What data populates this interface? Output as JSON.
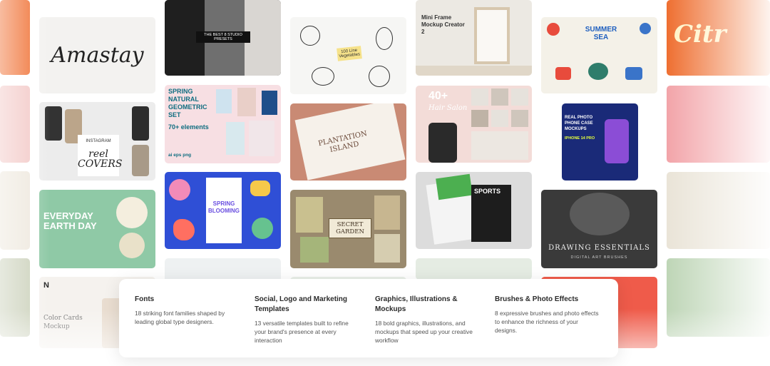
{
  "tiles": {
    "amastay": {
      "title": "Amastay"
    },
    "studio": {
      "title": "THE BEST 8 STUDIO PRESETS"
    },
    "veg": {
      "title": "100 Line Vegetables"
    },
    "miniframe": {
      "title": "Mini Frame Mockup Creator 2"
    },
    "summersea": {
      "title": "SUMMER SEA"
    },
    "citrus": {
      "title": "Citr"
    },
    "reel": {
      "title": "INSTAGRAM",
      "subtitle": "reel COVERS"
    },
    "geometric": {
      "title": "SPRING NATURAL GEOMETRIC SET",
      "count": "70+ elements",
      "formats": "ai eps png"
    },
    "plantation": {
      "title": "PLANTATION ISLAND"
    },
    "hairsalon": {
      "count": "40+",
      "title": "Hair Salon"
    },
    "phonecase": {
      "title": "REAL PHOTO PHONE CASE MOCKUPS",
      "subtitle": "IPHONE 14 PRO"
    },
    "earthday": {
      "title": "EVERYDAY EARTH DAY"
    },
    "blooming": {
      "title": "SPRING BLOOMING"
    },
    "garden": {
      "title": "SECRET GARDEN"
    },
    "sports": {
      "title": "SPORTS"
    },
    "drawing": {
      "title": "DRAWING ESSENTIALS",
      "subtitle": "DIGITAL ART BRUSHES"
    },
    "colorcards": {
      "title": "Color Cards Mockup"
    }
  },
  "features": [
    {
      "title": "Fonts",
      "desc": "18 striking font families shaped by leading global type designers."
    },
    {
      "title": "Social, Logo and Marketing Templates",
      "desc": "13 versatile templates built to refine your brand's presence at every interaction"
    },
    {
      "title": "Graphics, Illustrations & Mockups",
      "desc": "18 bold graphics, illustrations, and mockups that speed up your creative workflow"
    },
    {
      "title": "Brushes & Photo Effects",
      "desc": "8 expressive brushes and photo effects to enhance the richness of your designs."
    }
  ],
  "colors": {
    "panel": "#ffffff",
    "heading": "#2b2b2b",
    "body": "#555555"
  }
}
